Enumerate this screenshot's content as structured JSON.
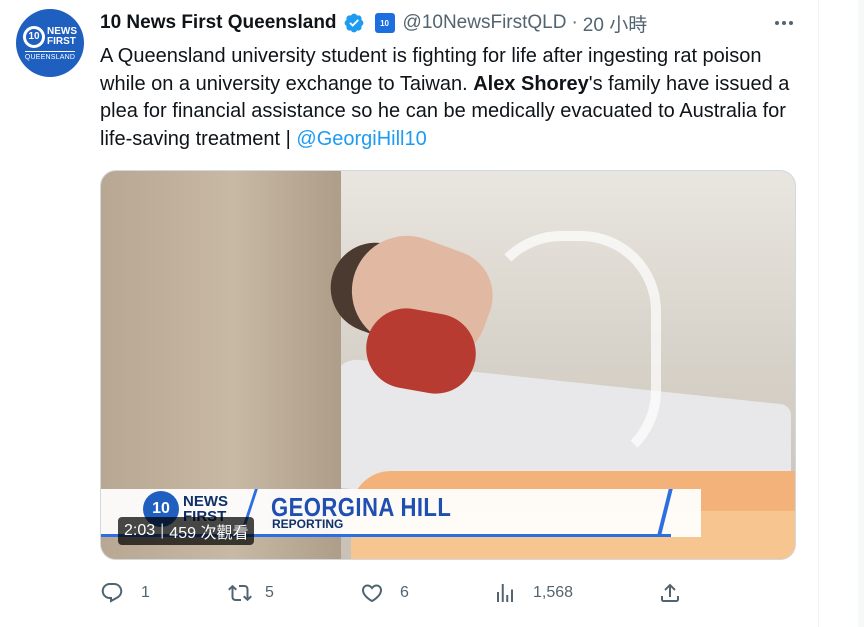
{
  "author": {
    "display_name": "10 News First Queensland",
    "handle": "@10NewsFirstQLD",
    "separator": "·",
    "time": "20 小時",
    "avatar": {
      "number": "10",
      "brand": "NEWS FIRST",
      "region": "QUEENSLAND"
    },
    "affiliate_badge": "10"
  },
  "tweet": {
    "text_1": "A Queensland university student is fighting for life after ingesting rat poison while on a university exchange to Taiwan. ",
    "name_bold": "Alex Shorey",
    "text_2": "'s family have issued a plea for financial assistance so he can be medically evacuated to Australia for life-saving treatment | ",
    "mention": "@GeorgiHill10"
  },
  "video": {
    "lower_third_logo_number": "10",
    "lower_third_brand": "NEWS\nFIRST",
    "reporter_name": "GEORGINA HILL",
    "reporter_role": "REPORTING",
    "duration": "2:03",
    "views": "459 次觀看"
  },
  "actions": {
    "reply_count": "1",
    "retweet_count": "5",
    "like_count": "6",
    "views_count": "1,568"
  },
  "colors": {
    "link": "#1d9bf0",
    "verified": "#1d9bf0",
    "muted": "#536471",
    "brand_blue": "#1f5fc0"
  },
  "icons": [
    "verified-badge-icon",
    "more-icon",
    "reply-icon",
    "retweet-icon",
    "like-icon",
    "views-icon",
    "share-icon"
  ]
}
